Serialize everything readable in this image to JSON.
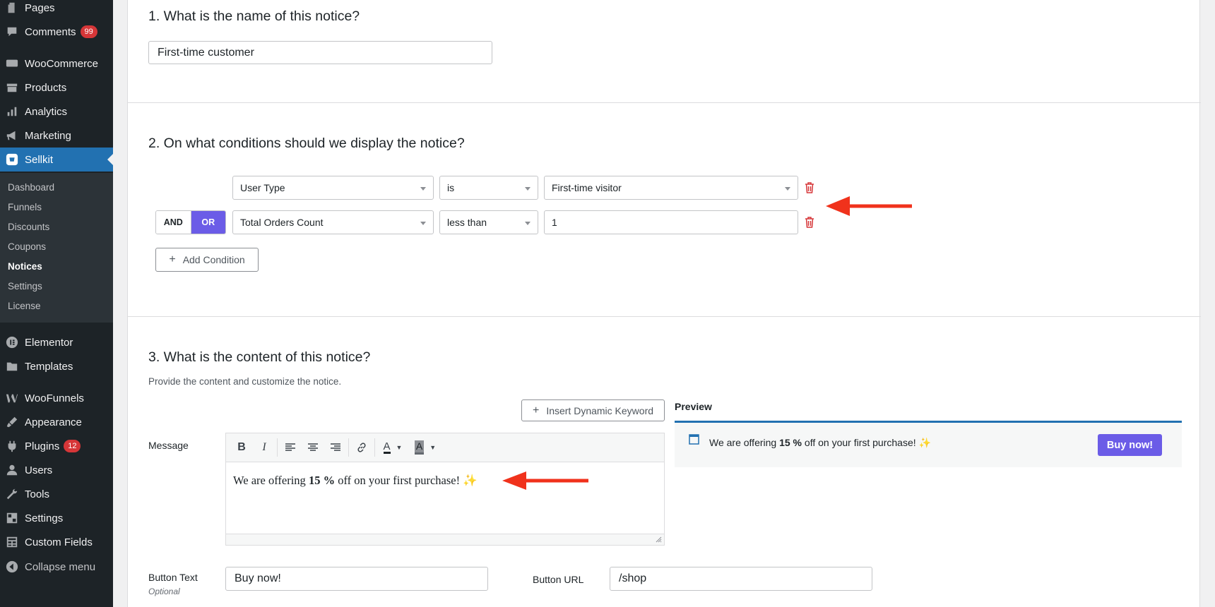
{
  "sidebar": {
    "menu": [
      {
        "label": "Pages",
        "icon": "pages-icon"
      },
      {
        "label": "Comments",
        "icon": "comments-icon",
        "badge": "99"
      },
      {
        "label": "WooCommerce",
        "icon": "woocommerce-icon"
      },
      {
        "label": "Products",
        "icon": "products-icon"
      },
      {
        "label": "Analytics",
        "icon": "analytics-icon"
      },
      {
        "label": "Marketing",
        "icon": "marketing-icon"
      },
      {
        "label": "Sellkit",
        "icon": "sellkit-icon"
      },
      {
        "label": "Elementor",
        "icon": "elementor-icon"
      },
      {
        "label": "Templates",
        "icon": "templates-icon"
      },
      {
        "label": "WooFunnels",
        "icon": "woofunnels-icon"
      },
      {
        "label": "Appearance",
        "icon": "appearance-icon"
      },
      {
        "label": "Plugins",
        "icon": "plugins-icon",
        "badge": "12"
      },
      {
        "label": "Users",
        "icon": "users-icon"
      },
      {
        "label": "Tools",
        "icon": "tools-icon"
      },
      {
        "label": "Settings",
        "icon": "settings-icon"
      },
      {
        "label": "Custom Fields",
        "icon": "custom-fields-icon"
      },
      {
        "label": "Collapse menu",
        "icon": "collapse-icon"
      }
    ],
    "submenu": [
      "Dashboard",
      "Funnels",
      "Discounts",
      "Coupons",
      "Notices",
      "Settings",
      "License"
    ],
    "current_submenu": "Notices"
  },
  "section1": {
    "title": "1. What is the name of this notice?",
    "name_value": "First-time customer"
  },
  "section2": {
    "title": "2. On what conditions should we display the notice?",
    "conditions": [
      {
        "field": "User Type",
        "operator": "is",
        "value": "First-time visitor"
      },
      {
        "field": "Total Orders Count",
        "operator": "less than",
        "value": "1"
      }
    ],
    "and_label": "AND",
    "or_label": "OR",
    "add_condition_label": "Add Condition"
  },
  "section3": {
    "title": "3. What is the content of this notice?",
    "description": "Provide the content and customize the notice.",
    "insert_keyword_label": "Insert Dynamic Keyword",
    "message_label": "Message",
    "message": {
      "before": "We are offering ",
      "bold": "15 %",
      "after": " off on your first purchase! ",
      "emoji": "✨"
    },
    "preview_label": "Preview",
    "preview_button": "Buy now!",
    "button_text_label": "Button Text",
    "button_text_optional": "Optional",
    "button_text_value": "Buy now!",
    "button_url_label": "Button URL",
    "button_url_value": "/shop"
  },
  "colors": {
    "sidebar_bg": "#1d2327",
    "active_menu": "#2271b1",
    "accent_purple": "#6b5ce7",
    "delete_red": "#d63638",
    "annotation_arrow": "#f0321c"
  }
}
